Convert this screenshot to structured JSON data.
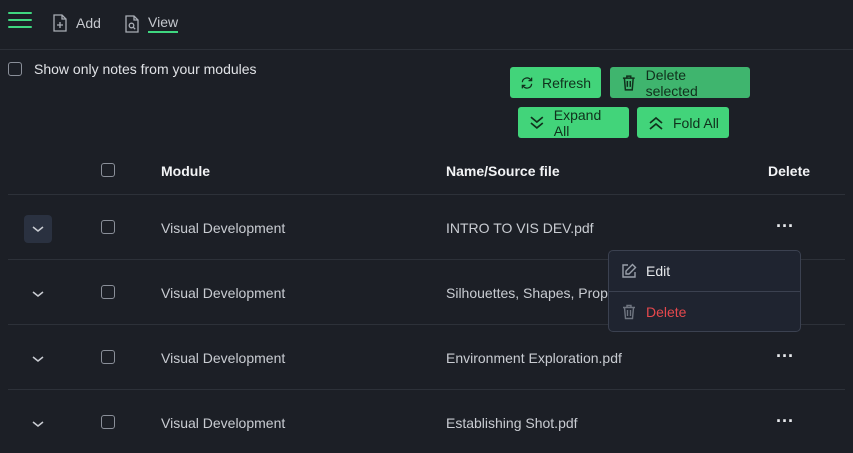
{
  "toolbar": {
    "add_label": "Add",
    "view_label": "View"
  },
  "filter": {
    "only_mine_label": "Show only notes from your modules"
  },
  "actions": {
    "refresh_label": "Refresh",
    "delete_selected_label": "Delete selected",
    "expand_all_label": "Expand All",
    "fold_all_label": "Fold All"
  },
  "table": {
    "headers": {
      "module": "Module",
      "name": "Name/Source file",
      "delete": "Delete"
    },
    "rows": [
      {
        "module": "Visual Development",
        "name": "INTRO TO VIS DEV.pdf"
      },
      {
        "module": "Visual Development",
        "name": "Silhouettes, Shapes, Propo"
      },
      {
        "module": "Visual Development",
        "name": "Environment Exploration.pdf"
      },
      {
        "module": "Visual Development",
        "name": "Establishing Shot.pdf"
      }
    ]
  },
  "context_menu": {
    "edit_label": "Edit",
    "delete_label": "Delete"
  },
  "colors": {
    "accent": "#42d47a",
    "background": "#1c1f26",
    "danger": "#e5484d"
  }
}
